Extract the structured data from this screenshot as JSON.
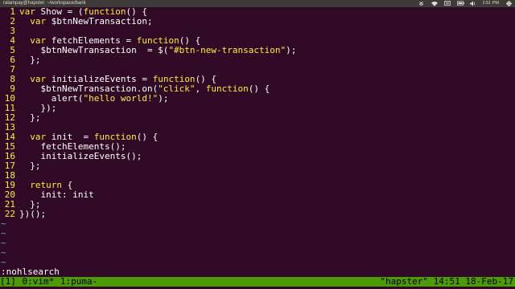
{
  "top_bar": {
    "title": "ralampay@hapster: ~/workspace/bank",
    "clock": "2:51 PM",
    "icons": [
      "dropbox-icon",
      "wifi-icon",
      "keyboard-icon",
      "battery-icon",
      "volume-icon",
      "settings-icon"
    ]
  },
  "editor": {
    "lines": [
      {
        "n": "1",
        "tokens": [
          {
            "t": "var",
            "c": "kw"
          },
          {
            "t": " Show = (",
            "c": "text"
          },
          {
            "t": "function",
            "c": "kw"
          },
          {
            "t": "() {",
            "c": "text"
          }
        ]
      },
      {
        "n": "2",
        "tokens": [
          {
            "t": "  ",
            "c": "text"
          },
          {
            "t": "var",
            "c": "kw"
          },
          {
            "t": " $btnNewTransaction;",
            "c": "text"
          }
        ]
      },
      {
        "n": "3",
        "tokens": []
      },
      {
        "n": "4",
        "tokens": [
          {
            "t": "  ",
            "c": "text"
          },
          {
            "t": "var",
            "c": "kw"
          },
          {
            "t": " fetchElements = ",
            "c": "text"
          },
          {
            "t": "function",
            "c": "kw"
          },
          {
            "t": "() {",
            "c": "text"
          }
        ]
      },
      {
        "n": "5",
        "tokens": [
          {
            "t": "    $btnNewTransaction  = $(",
            "c": "text"
          },
          {
            "t": "\"#btn-new-transaction\"",
            "c": "str"
          },
          {
            "t": ");",
            "c": "text"
          }
        ]
      },
      {
        "n": "6",
        "tokens": [
          {
            "t": "  };",
            "c": "text"
          }
        ]
      },
      {
        "n": "7",
        "tokens": []
      },
      {
        "n": "8",
        "tokens": [
          {
            "t": "  ",
            "c": "text"
          },
          {
            "t": "var",
            "c": "kw"
          },
          {
            "t": " initializeEvents = ",
            "c": "text"
          },
          {
            "t": "function",
            "c": "kw"
          },
          {
            "t": "() {",
            "c": "text"
          }
        ]
      },
      {
        "n": "9",
        "tokens": [
          {
            "t": "    $btnNewTransaction.on(",
            "c": "text"
          },
          {
            "t": "\"click\"",
            "c": "str"
          },
          {
            "t": ", ",
            "c": "text"
          },
          {
            "t": "function",
            "c": "kw"
          },
          {
            "t": "() {",
            "c": "text"
          }
        ]
      },
      {
        "n": "10",
        "tokens": [
          {
            "t": "      alert(",
            "c": "text"
          },
          {
            "t": "\"hello world!\"",
            "c": "str"
          },
          {
            "t": ");",
            "c": "text"
          }
        ]
      },
      {
        "n": "11",
        "tokens": [
          {
            "t": "    });",
            "c": "text"
          }
        ]
      },
      {
        "n": "12",
        "tokens": [
          {
            "t": "  };",
            "c": "text"
          }
        ]
      },
      {
        "n": "13",
        "tokens": []
      },
      {
        "n": "14",
        "tokens": [
          {
            "t": "  ",
            "c": "text"
          },
          {
            "t": "var",
            "c": "kw"
          },
          {
            "t": " init  = ",
            "c": "text"
          },
          {
            "t": "function",
            "c": "kw"
          },
          {
            "t": "() {",
            "c": "text"
          }
        ]
      },
      {
        "n": "15",
        "tokens": [
          {
            "t": "    fetchElements();",
            "c": "text"
          }
        ]
      },
      {
        "n": "16",
        "tokens": [
          {
            "t": "    initializeEvents();",
            "c": "text"
          }
        ]
      },
      {
        "n": "17",
        "tokens": [
          {
            "t": "  };",
            "c": "text"
          }
        ]
      },
      {
        "n": "18",
        "tokens": []
      },
      {
        "n": "19",
        "tokens": [
          {
            "t": "  ",
            "c": "text"
          },
          {
            "t": "return",
            "c": "kw"
          },
          {
            "t": " {",
            "c": "text"
          }
        ]
      },
      {
        "n": "20",
        "tokens": [
          {
            "t": "    init: init",
            "c": "text"
          }
        ]
      },
      {
        "n": "21",
        "tokens": [
          {
            "t": "  };",
            "c": "text"
          }
        ]
      },
      {
        "n": "22",
        "tokens": [
          {
            "t": "})();",
            "c": "text"
          }
        ]
      }
    ],
    "tilde_lines": [
      "~",
      "~",
      "~",
      "~",
      "~"
    ]
  },
  "command_line": ":nohlsearch",
  "tmux": {
    "session": "[1]",
    "windows": [
      "0:vim*",
      "1:puma-"
    ],
    "status_right": "\"hapster\" 14:51 18-Feb-17"
  },
  "colors": {
    "background": "#300a24",
    "line_number": "#fce94f",
    "keyword": "#fce94f",
    "string": "#fce94f",
    "tilde": "#729fcf",
    "tmux_bar": "#4e9a06",
    "top_bar": "#3c3b37"
  }
}
